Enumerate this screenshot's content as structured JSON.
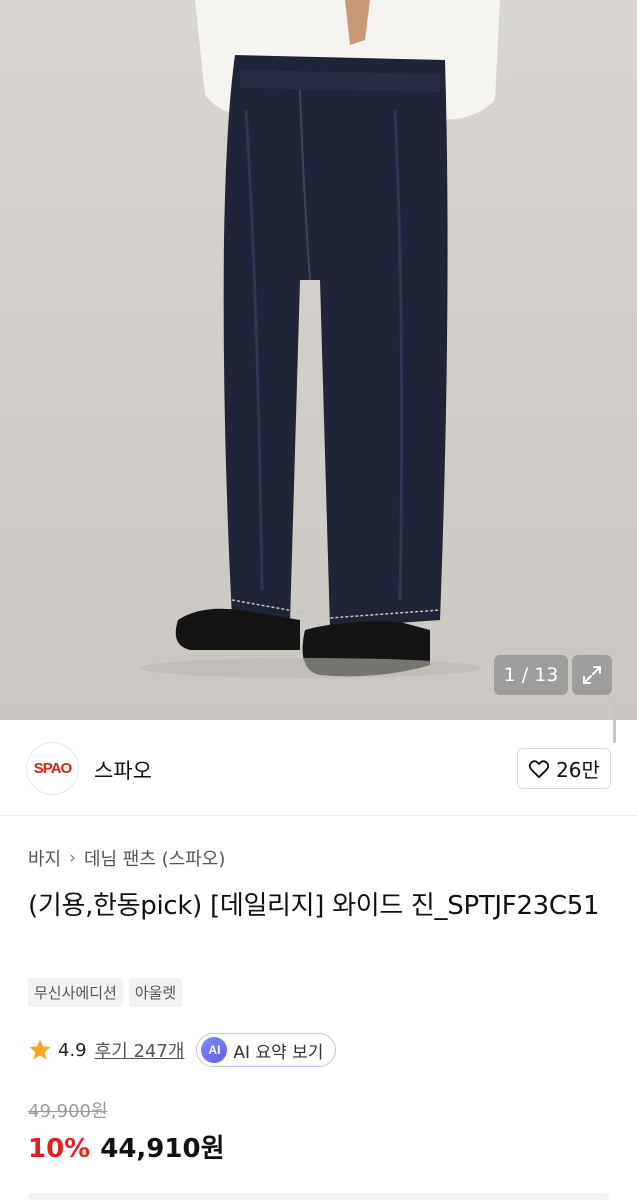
{
  "gallery": {
    "counter": "1 / 13"
  },
  "brand": {
    "logo_text": "SPAO",
    "name": "스파오",
    "like_count": "26만"
  },
  "breadcrumb": {
    "items": [
      "바지",
      "데님 팬츠 (스파오)"
    ]
  },
  "product": {
    "title": "(기용,한동pick) [데일리지] 와이드 진_SPTJF23C51",
    "tags": [
      "무신사에디션",
      "아울렛"
    ]
  },
  "rating": {
    "score": "4.9",
    "reviews": "후기 247개",
    "ai_badge": "AI",
    "ai_label": "AI 요약 보기"
  },
  "price": {
    "original": "49,900원",
    "discount": "10%",
    "sale": "44,910원"
  },
  "colors": {
    "discount": "#e02121",
    "star": "#f5a623",
    "brand_logo": "#d8211a"
  }
}
